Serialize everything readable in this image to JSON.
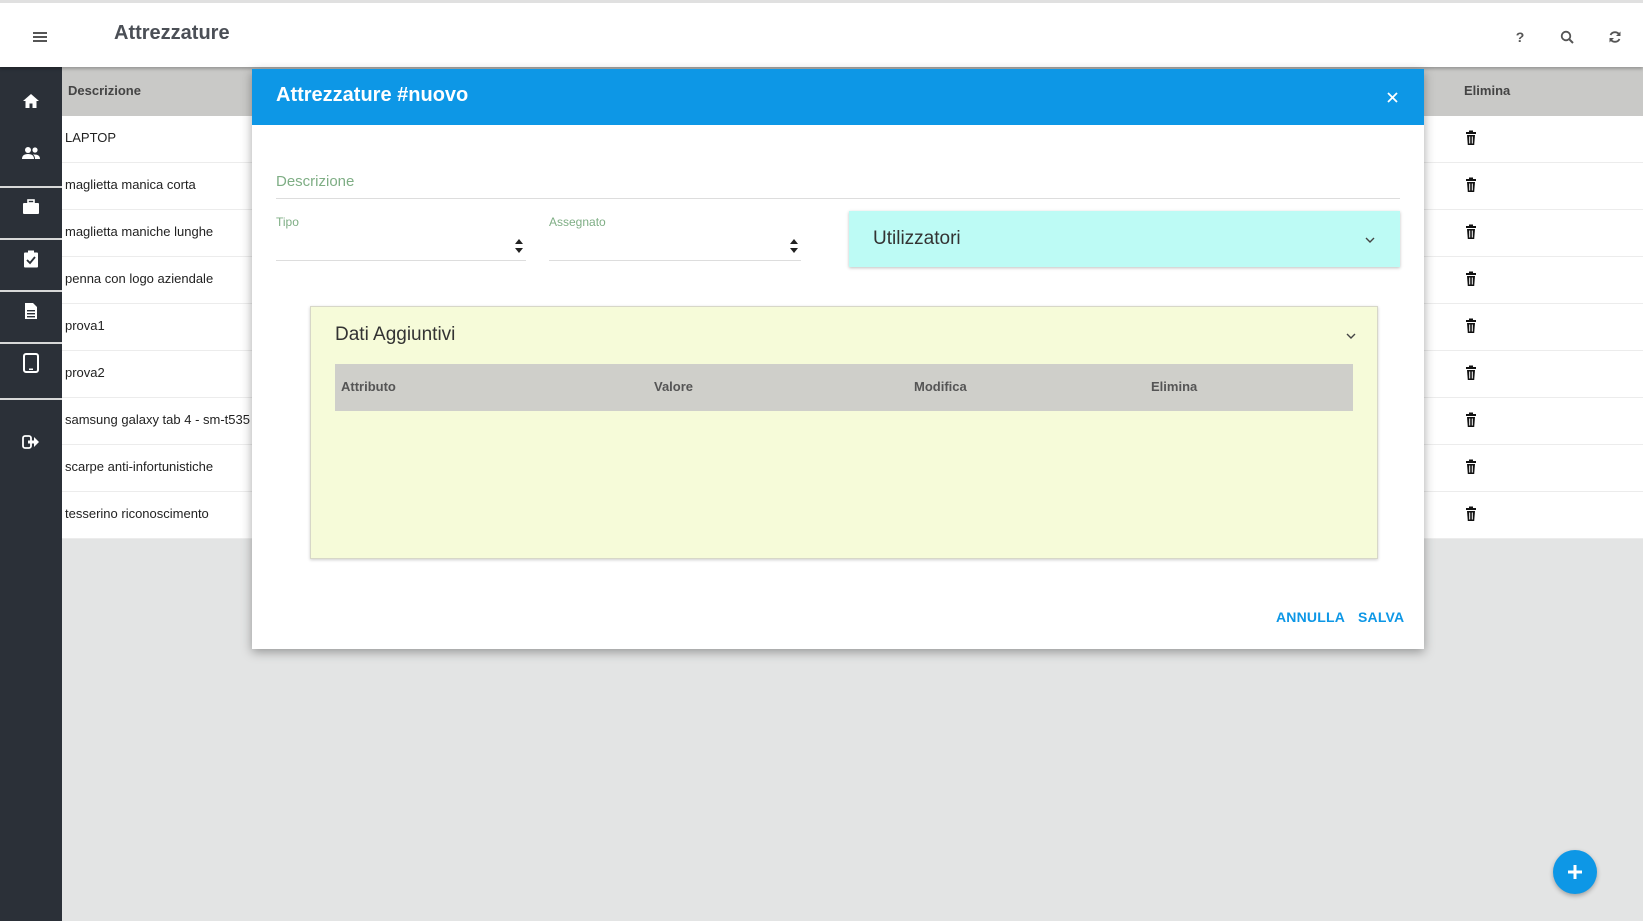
{
  "header": {
    "title": "Attrezzature",
    "icons": [
      "menu-icon",
      "help-icon",
      "search-icon",
      "refresh-icon"
    ],
    "help_label": "?"
  },
  "sidebar": {
    "items": [
      {
        "icon": "home-icon"
      },
      {
        "icon": "people-icon"
      },
      {
        "icon": "briefcase-icon"
      },
      {
        "icon": "clipboard-check-icon"
      },
      {
        "icon": "document-icon"
      },
      {
        "icon": "tablet-icon"
      },
      {
        "icon": "logout-icon"
      }
    ]
  },
  "table": {
    "columns": {
      "description": "Descrizione",
      "delete": "Elimina"
    },
    "rows": [
      "LAPTOP",
      "maglietta manica corta",
      "maglietta maniche lunghe",
      "penna con logo aziendale",
      "prova1",
      "prova2",
      "samsung galaxy tab 4 - sm-t535",
      "scarpe anti-infortunistiche",
      "tesserino riconoscimento"
    ]
  },
  "modal": {
    "title": "Attrezzature #nuovo",
    "description_placeholder": "Descrizione",
    "description_value": "",
    "tipo_label": "Tipo",
    "tipo_value": "",
    "assegnato_label": "Assegnato",
    "assegnato_value": "",
    "utilizzatori_label": "Utilizzatori",
    "dati_label": "Dati Aggiuntivi",
    "dati_columns": [
      "Attributo",
      "Valore",
      "Modifica",
      "Elimina"
    ],
    "cancel_label": "ANNULLA",
    "save_label": "SALVA"
  },
  "colors": {
    "accent": "#0d97e6",
    "sidebar": "#2b3038",
    "utilizzatori_bg": "#bdfbf5",
    "dati_bg": "#f6fbd9",
    "label_green": "#7fae85"
  }
}
